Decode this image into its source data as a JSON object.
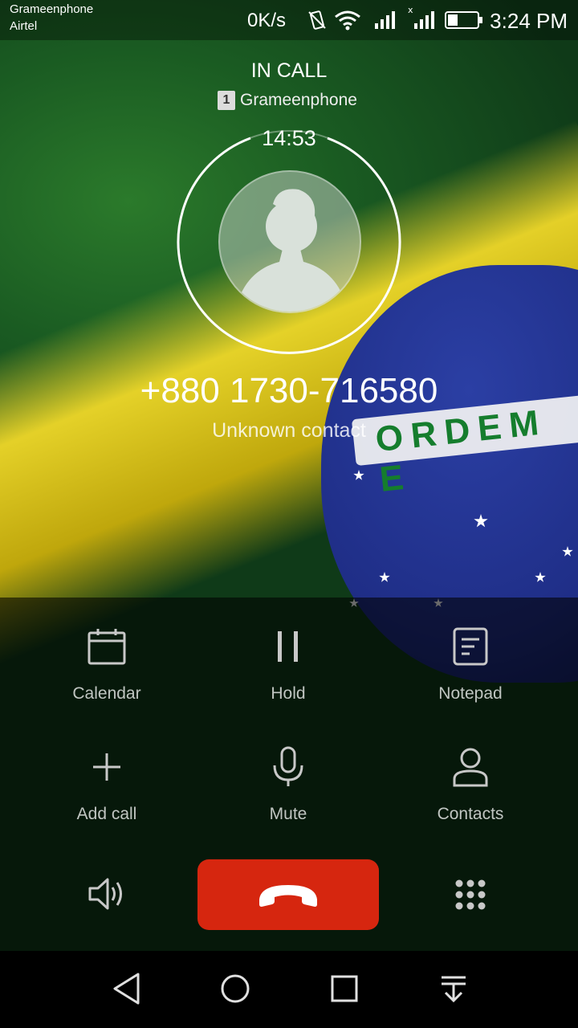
{
  "status_bar": {
    "carrier_1": "Grameenphone",
    "carrier_2": "Airtel",
    "network_speed": "0K/s",
    "time": "3:24 PM",
    "icons": [
      "vibrate-icon",
      "wifi-icon",
      "signal-icon",
      "signal-icon",
      "battery-icon"
    ]
  },
  "call": {
    "status": "IN CALL",
    "sim_slot": "1",
    "sim_operator": "Grameenphone",
    "duration": "14:53",
    "number": "+880 1730-716580",
    "contact_label": "Unknown contact"
  },
  "actions": [
    {
      "label": "Calendar",
      "icon": "calendar-icon"
    },
    {
      "label": "Hold",
      "icon": "pause-icon"
    },
    {
      "label": "Notepad",
      "icon": "notepad-icon"
    },
    {
      "label": "Add call",
      "icon": "plus-icon"
    },
    {
      "label": "Mute",
      "icon": "microphone-icon"
    },
    {
      "label": "Contacts",
      "icon": "person-icon"
    }
  ],
  "bottom_controls": [
    "speaker-icon",
    "end-call-icon",
    "dialpad-icon"
  ],
  "navigation": [
    "back-icon",
    "home-icon",
    "recents-icon",
    "notification-pull-icon"
  ],
  "colors": {
    "end_call": "#d6260f",
    "flag_green": "#1a5b22",
    "flag_yellow": "#f6dc29",
    "flag_blue": "#1f2e87"
  }
}
